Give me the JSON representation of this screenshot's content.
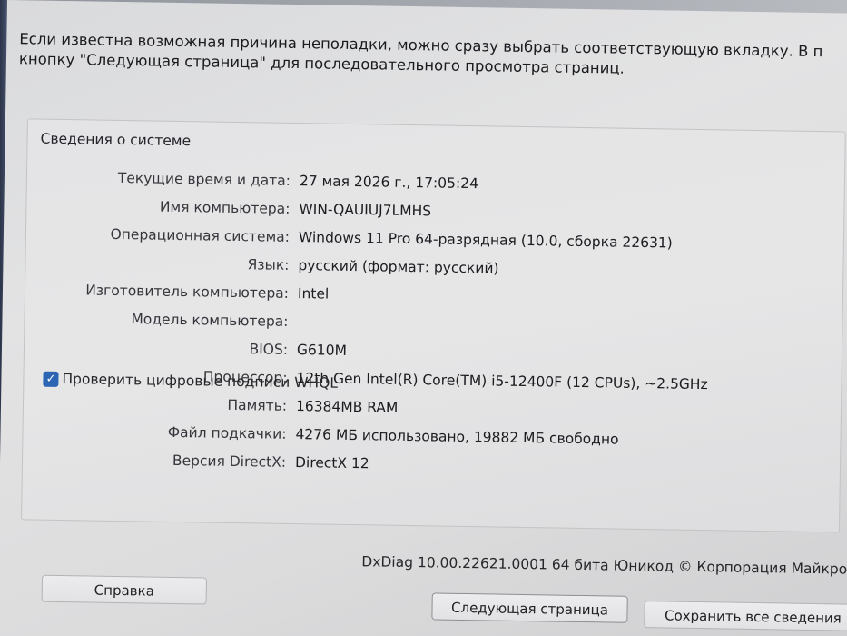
{
  "intro": {
    "line1": "Если известна возможная причина неполадки, можно сразу выбрать соответствующую вкладку. В п",
    "line2": "кнопку \"Следующая страница\" для последовательного просмотра страниц."
  },
  "system_info": {
    "title": "Сведения о системе",
    "rows": [
      {
        "label": "Текущие время и дата:",
        "value": "27 мая 2026 г., 17:05:24"
      },
      {
        "label": "Имя компьютера:",
        "value": "WIN-QAUIUJ7LMHS"
      },
      {
        "label": "Операционная система:",
        "value": "Windows 11 Pro 64-разрядная (10.0, сборка 22631)"
      },
      {
        "label": "Язык:",
        "value": "русский (формат: русский)"
      },
      {
        "label": "Изготовитель компьютера:",
        "value": "Intel"
      },
      {
        "label": "Модель компьютера:",
        "value": ""
      },
      {
        "label": "BIOS:",
        "value": "G610M"
      },
      {
        "label": "Процессор:",
        "value": "12th Gen Intel(R) Core(TM) i5-12400F (12 CPUs), ~2.5GHz"
      },
      {
        "label": "Память:",
        "value": "16384MB RAM"
      },
      {
        "label": "Файл подкачки:",
        "value": "4276 МБ использовано, 19882 МБ свободно"
      },
      {
        "label": "Версия DirectX:",
        "value": "DirectX 12"
      }
    ]
  },
  "whql_checkbox": {
    "label": "Проверить цифровые подписи WHQL",
    "checked": true
  },
  "footer": {
    "version_text": "DxDiag 10.00.22621.0001 64 бита Юникод © Корпорация Майкро"
  },
  "buttons": {
    "help": "Справка",
    "next_page": "Следующая страница",
    "save_all": "Сохранить все сведения"
  },
  "colors": {
    "accent": "#2d65b5"
  }
}
